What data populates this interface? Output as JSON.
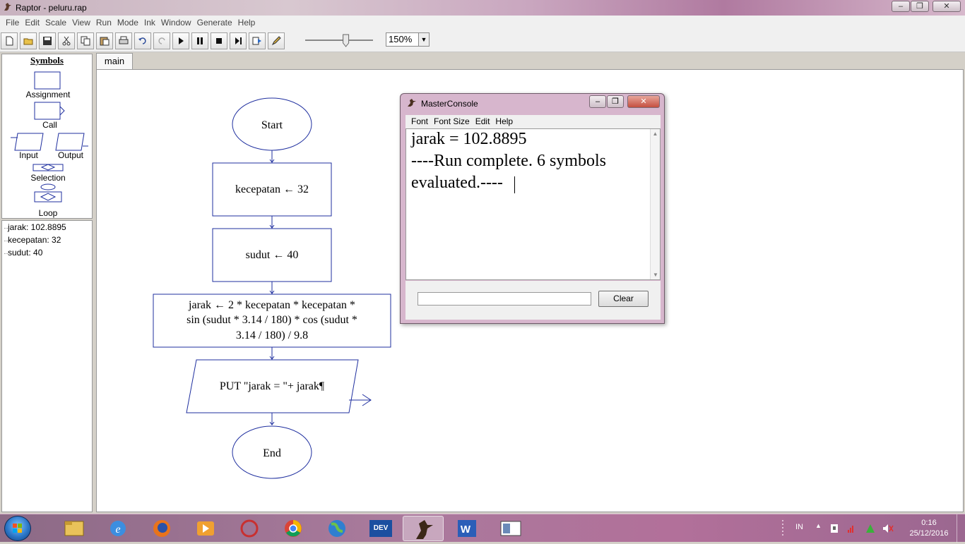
{
  "window": {
    "title": "Raptor - peluru.rap"
  },
  "menu": [
    "File",
    "Edit",
    "Scale",
    "View",
    "Run",
    "Mode",
    "Ink",
    "Window",
    "Generate",
    "Help"
  ],
  "toolbar": {
    "buttons": [
      "new-icon",
      "open-icon",
      "save-icon",
      "cut-icon",
      "copy-icon",
      "paste-icon",
      "print-icon",
      "undo-icon",
      "redo-icon",
      "play-icon",
      "pause-icon",
      "stop-icon",
      "step-icon",
      "run-to-completion-icon",
      "pen-icon"
    ],
    "zoom_value": "150%",
    "speed_slider_level": 0.6
  },
  "symbols": {
    "heading": "Symbols",
    "items": {
      "assignment": "Assignment",
      "call": "Call",
      "input": "Input",
      "output": "Output",
      "selection": "Selection",
      "loop": "Loop"
    }
  },
  "variables": [
    "jarak: 102.8895",
    "kecepatan: 32",
    "sudut: 40"
  ],
  "tabs": {
    "main": "main"
  },
  "flowchart": {
    "start": "Start",
    "step1": "kecepatan ← 32",
    "step2": "sudut ←  40",
    "step3_lines": [
      "jarak ← 2  *  kecepatan  * kecepatan  *",
      "sin (sudut  *  3.14  /  180)  *  cos (sudut  *",
      "3.14  /  180)  / 9.8"
    ],
    "output": "PUT \"jarak = \"+ jarak¶",
    "end": "End"
  },
  "console": {
    "title": "MasterConsole",
    "menu": [
      "Font",
      "Font Size",
      "Edit",
      "Help"
    ],
    "output_lines": [
      "jarak = 102.8895",
      "----Run complete.  6 symbols",
      "evaluated.----"
    ],
    "input_value": "",
    "clear_label": "Clear"
  },
  "taskbar": {
    "apps": [
      "explorer-icon",
      "ie-icon",
      "firefox-icon",
      "media-player-icon",
      "pdf-icon",
      "chrome-icon",
      "earth-icon",
      "devcpp-icon",
      "raptor-icon",
      "word-icon",
      "document-icon"
    ],
    "language": "IN",
    "time": "0:16",
    "date": "25/12/2016"
  },
  "colors": {
    "flow_stroke": "#1f2f9f",
    "titlebar_accent": "#b07aa0",
    "taskbar_accent": "#a97a9c"
  }
}
